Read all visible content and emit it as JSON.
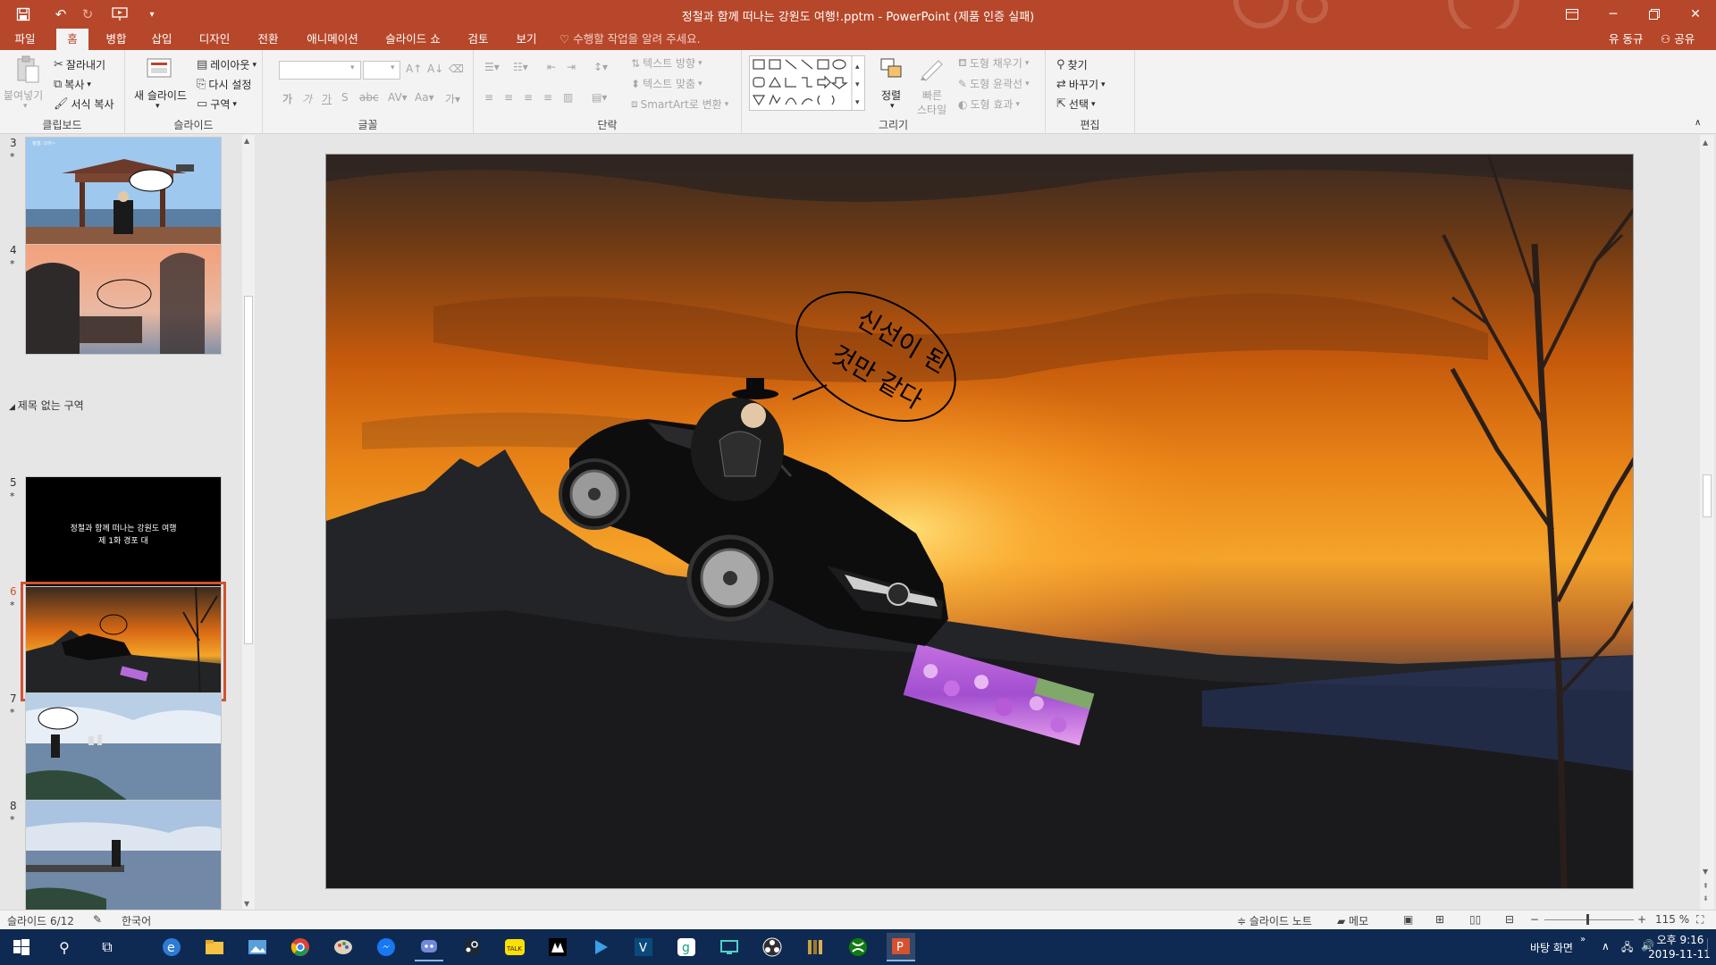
{
  "titlebar": {
    "document_title": "정철과 함께 떠나는 강원도 여행!.pptm - PowerPoint (제품 인증 실패)",
    "quick_access": [
      "save-icon",
      "undo-icon",
      "redo-icon",
      "present-from-start-icon",
      "customize-qat-icon"
    ]
  },
  "tabs": [
    {
      "label": "파일"
    },
    {
      "label": "홈",
      "active": true
    },
    {
      "label": "병합"
    },
    {
      "label": "삽입"
    },
    {
      "label": "디자인"
    },
    {
      "label": "전환"
    },
    {
      "label": "애니메이션"
    },
    {
      "label": "슬라이드 쇼"
    },
    {
      "label": "검토"
    },
    {
      "label": "보기"
    }
  ],
  "tell_me": "수행할 작업을 알려 주세요.",
  "account": {
    "user": "유 동규",
    "share": "공유"
  },
  "ribbon": {
    "clipboard": {
      "label": "클립보드",
      "paste": "붙여넣기",
      "cut": "잘라내기",
      "copy": "복사",
      "format_painter": "서식 복사"
    },
    "slides": {
      "label": "슬라이드",
      "new_slide": "새 슬라이드",
      "layout": "레이아웃",
      "reset": "다시 설정",
      "section": "구역"
    },
    "font": {
      "label": "글꼴",
      "font_name": "",
      "font_size": ""
    },
    "paragraph": {
      "label": "단락",
      "text_direction": "텍스트 방향",
      "align_text": "텍스트 맞춤",
      "smartart": "SmartArt로 변환"
    },
    "drawing": {
      "label": "그리기",
      "arrange": "정렬",
      "quick_styles_1": "빠른",
      "quick_styles_2": "스타일",
      "shape_fill": "도형 채우기",
      "shape_outline": "도형 윤곽선",
      "shape_effects": "도형 효과"
    },
    "editing": {
      "label": "편집",
      "find": "찾기",
      "replace": "바꾸기",
      "select": "선택"
    }
  },
  "thumbnails": {
    "section_name": "제목 없는 구역",
    "slides": [
      {
        "num": "3",
        "star": "*",
        "caption": "정철: 으아~"
      },
      {
        "num": "4",
        "star": "*"
      },
      {
        "num": "5",
        "star": "*",
        "caption_line1": "정철과 함께 떠나는 강원도 여행",
        "caption_line2": "제 1화 경포 대"
      },
      {
        "num": "6",
        "star": "*",
        "selected": true
      },
      {
        "num": "7",
        "star": "*"
      },
      {
        "num": "8",
        "star": "*"
      }
    ]
  },
  "slide": {
    "speech_line1": "신선이 된",
    "speech_line2": "것만 같다"
  },
  "statusbar": {
    "slide_info": "슬라이드 6/12",
    "language": "한국어",
    "notes": "슬라이드 노트",
    "comments": "메모",
    "zoom": "115 %"
  },
  "taskbar": {
    "desktop_label": "바탕 화면",
    "time": "오후 9:16",
    "date": "2019-11-11",
    "apps": [
      "start-icon",
      "search-icon",
      "task-view-icon",
      "edge-icon",
      "file-explorer-icon",
      "photos-icon",
      "chrome-icon",
      "paint-icon",
      "messenger-icon",
      "discord-icon",
      "steam-icon",
      "kakaotalk-icon",
      "unreal-icon",
      "video-player-icon",
      "vegas-icon",
      "gom-icon",
      "remote-icon",
      "obs-icon",
      "library-icon",
      "xbox-icon",
      "powerpoint-icon"
    ]
  },
  "colors": {
    "accent": "#b7472a",
    "selection": "#d35230",
    "taskbar": "#0f2a52"
  }
}
